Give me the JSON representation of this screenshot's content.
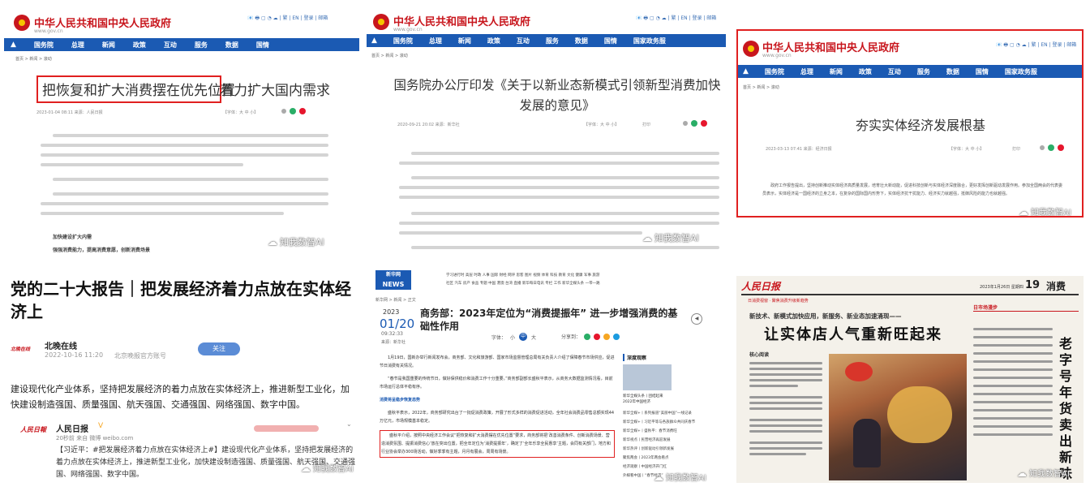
{
  "watermark": "知我数智AI",
  "panel1": {
    "site_title": "中华人民共和国中央人民政府",
    "site_url": "www.gov.cn",
    "utils": "📧 🖶 ▢ ◔ ☁ | 繁 | EN | 登录 | 邮箱",
    "nav": [
      "国务院",
      "总理",
      "新闻",
      "政策",
      "互动",
      "服务",
      "数据",
      "国情"
    ],
    "breadcrumb": "首页 > 新闻 > 滚动",
    "headline_highlight": "把恢复和扩大消费摆在优先位置",
    "headline_rest": "着力扩大国内需求",
    "meta": "2023-01-04 08:11   来源：人民日报",
    "font_size": "【字体：大 中 小】",
    "section1": "加快建设扩大内需",
    "section2": "强强消费能力，提高消费意愿，创新消费场景"
  },
  "panel2": {
    "site_title": "中华人民共和国中央人民政府",
    "site_url": "www.gov.cn",
    "utils": "📧 🖶 ▢ ◔ ☁ | 繁 | EN | 登录 | 邮箱",
    "nav": [
      "国务院",
      "总理",
      "新闻",
      "政策",
      "互动",
      "服务",
      "数据",
      "国情",
      "国家政务服"
    ],
    "breadcrumb": "首页 > 新闻 > 滚动",
    "headline": "国务院办公厅印发《关于以新业态新模式引领新型消费加快发展的意见》",
    "meta": "2020-09-21 20:02   来源：新华社",
    "font_size": "【字体：大 中 小】",
    "print": "打印"
  },
  "panel3": {
    "site_title": "中华人民共和国中央人民政府",
    "site_url": "www.gov.cn",
    "utils": "📧 🖶 ▢ ◔ ☁ | 繁 | EN | 登录 | 邮箱",
    "nav": [
      "国务院",
      "总理",
      "新闻",
      "政策",
      "互动",
      "服务",
      "数据",
      "国情",
      "国家政务服"
    ],
    "breadcrumb": "首页 > 新闻 > 滚动",
    "headline": "夯实实体经济发展根基",
    "meta": "2023-03-13 07:41   来源：经济日报",
    "font_size": "【字体：大 中 小】",
    "print": "打印",
    "body": "政府工作报告提出，坚持创新推动实体经济高质量发展，培育壮大新动能，促进科技创新与实体经济深度融合，更好发挥创新驱动发展作用。参加全国两会的代表委员表示，实体经济是一国经济的立身之本，在复杂的国际国内形势下，实体经济抗干扰能力、经济实力就越强，抵御风险的能力也就越强。"
  },
  "panel4": {
    "headline": "党的二十大报告｜把发展经济着力点放在实体经济上",
    "account": "北晚在线",
    "account_logo": "北晚在线",
    "date": "2022-10-16 11:20",
    "source": "北京晚报官方账号",
    "follow": "关注",
    "body": "建设现代化产业体系，坚持把发展经济的着力点放在实体经济上，推进新型工业化，加快建设制造强国、质量强国、航天强国、交通强国、网络强国、数字中国。",
    "repost_name": "人民日报",
    "repost_meta": "20秒前 来自 微博 weibo.com",
    "repost_text": "【习近平：#把发展经济着力点放在实体经济上#】建设现代化产业体系，坚持把发展经济的着力点放在实体经济上，推进新型工业化，加快建设制造强国、质量强国、航天强国、交通强国、网络强国、数字中国。"
  },
  "panel5": {
    "logo": "新华网",
    "logo_sub": "NEWS",
    "top_nav": "学习进行时 高层 时政 人事 国际 财经 网评 思客 图片 视频 体育 科技 教育 文化 健康 军事 旅游",
    "top_nav2": "社区 汽车 房产 食品 专题 中国 港澳 台湾 直播 新华每日电讯 专栏 工作 新华全媒头条 一带一路",
    "breadcrumb": "新华网 > 新闻 > 正文",
    "year": "2023",
    "date": "01/20",
    "time": "09:32:33",
    "source": "来源：新华社",
    "headline": "商务部：2023年定位为“消费提振年” 进一步增强消费的基础性作用",
    "font_label": "字体：",
    "font_small": "小",
    "font_mid": "中",
    "font_big": "大",
    "share_label": "分享到：",
    "para1": "1月19日，国新办举行新闻发布会，商务部、文化和旅游部、国家市场监督管理总局有关负责人介绍了保障春节市场供应，促进节日消费有关情况。",
    "para2": "“春节是我国重要的传统节日，做好保供稳价和消费工作十分重要。”商务部副部长盛秋平表示，从商务大数据监测情况看，目前市场运行总体平稳有序。",
    "subhead": "消费将呈稳步恢复态势",
    "para3": "盛秋平表示，2022年，商务部研究出台了一批促消费政策，开展了形式多样的消费促进活动，全年社会消费品零售总额实现44万亿元，市场规模基本稳定。",
    "para4": "盛秋平介绍，按照中央经济工作会议“把恢复和扩大消费摆在优先位置”要求，商务部将把‘改善消费条件、创新消费场景、营造消费氛围、提振消费信心’放在突出位置，把全年定位为‘消费提振年’，确定了‘全年乐享全民惠享’主题，会同有关部门，地方和行业协会举办300场活动，做好季季有主题，月月有展会，周周有场景。",
    "sidebar_title": "深度观察",
    "sidebar_caption": "新华全媒头条丨团结起来2022年中国经济",
    "sidebar_links": [
      "新华全媒+丨系列报道“美丽中国”一线记录",
      "新华全媒+丨习近平等与各族群众共同庆春节",
      "新华全媒+丨盛秋平：春节消费旺",
      "新华视点丨民营经济再迎发展",
      "新华热评丨创新驱动引领新发展",
      "聚焦两会丨2023年两会看点",
      "经济观察丨中国经济开门红",
      "外媒看中国丨“春节经济”"
    ]
  },
  "panel6": {
    "paper_name": "人民日报",
    "date_line": "2023年1月26日  星期四",
    "page_number": "19",
    "page_name": "消费",
    "column_bar": "日消费视窗 · 聚焦消费升级新趋势",
    "kicker": "新技术、新模式加快应用，新服务、新业态加速涌现——",
    "headline": "让实体店人气重新旺起来",
    "side_label": "日市场漫步",
    "side_title": "老字号年货卖出新味道",
    "small_heading": "核心阅读"
  }
}
